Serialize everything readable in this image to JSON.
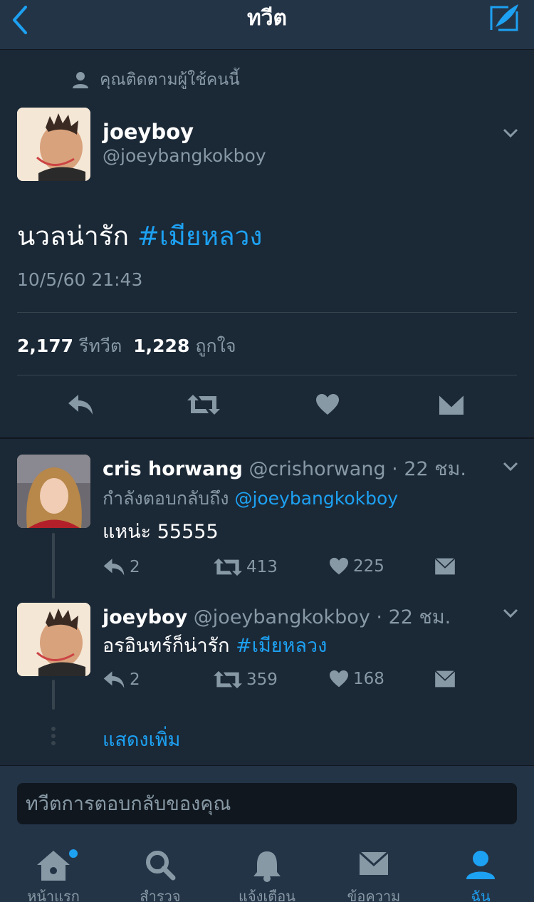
{
  "nav": {
    "title": "ทวีต"
  },
  "main_tweet": {
    "follow_note": "คุณติดตามผู้ใช้คนนี้",
    "name": "joeyboy",
    "handle": "@joeybangkokboy",
    "text": "นวลน่ารัก ",
    "hashtag": "#เมียหลวง",
    "timestamp": "10/5/60 21:43",
    "retweet_count": "2,177",
    "retweet_label": "รีทวีต",
    "like_count": "1,228",
    "like_label": "ถูกใจ"
  },
  "replies": [
    {
      "name": "cris horwang",
      "handle": "@crishorwang",
      "time": "· 22 ชม.",
      "replying_prefix": "กำลังตอบกลับถึง ",
      "replying_to": "@joeybangkokboy",
      "text": "แหน่ะ 55555",
      "reply_count": "2",
      "retweet_count": "413",
      "like_count": "225"
    },
    {
      "name": "joeyboy",
      "handle": "@joeybangkokboy",
      "time": "· 22 ชม.",
      "text": "อรอินทร์ก็น่ารัก ",
      "hashtag": "#เมียหลวง",
      "reply_count": "2",
      "retweet_count": "359",
      "like_count": "168"
    }
  ],
  "show_more": "แสดงเพิ่ม",
  "reply_input": {
    "placeholder": "ทวีตการตอบกลับของคุณ"
  },
  "tabbar": {
    "items": [
      {
        "label": "หน้าแรก",
        "icon": "home-icon"
      },
      {
        "label": "สำรวจ",
        "icon": "search-icon"
      },
      {
        "label": "แจ้งเตือน",
        "icon": "bell-icon"
      },
      {
        "label": "ข้อความ",
        "icon": "mail-icon"
      },
      {
        "label": "ฉัน",
        "icon": "profile-icon"
      }
    ]
  },
  "colors": {
    "background": "#1b2836",
    "nav_background": "#243447",
    "accent": "#1da1f2",
    "secondary_text": "#8899a6"
  }
}
